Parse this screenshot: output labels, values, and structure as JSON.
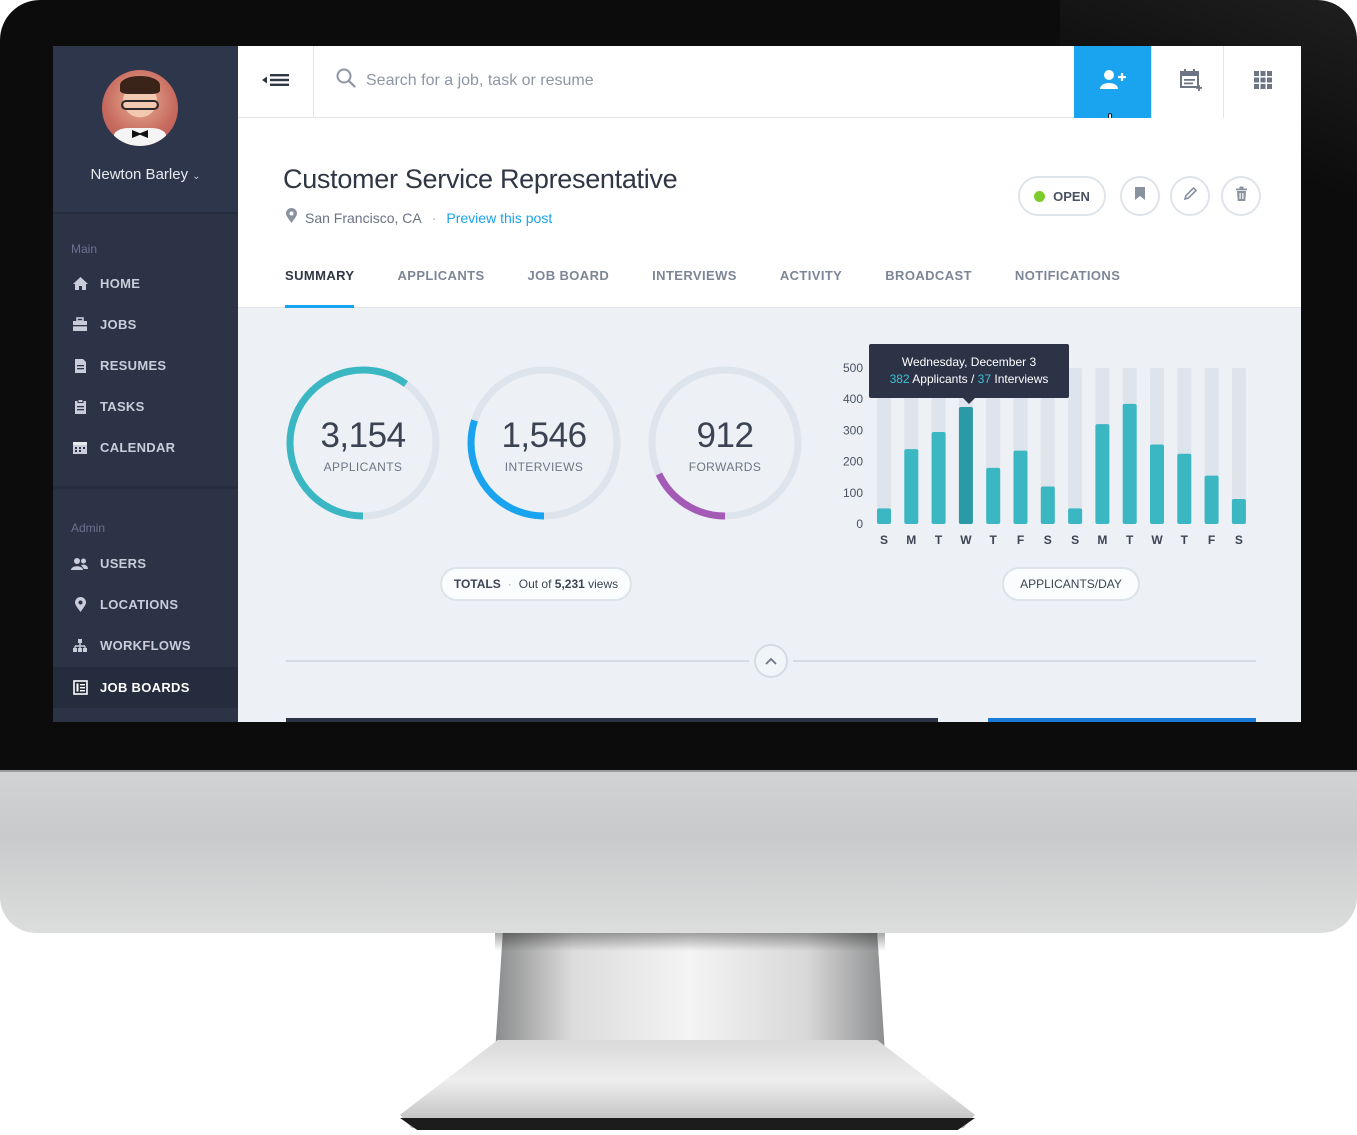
{
  "user": {
    "name": "Newton Barley"
  },
  "sidebar": {
    "main_label": "Main",
    "admin_label": "Admin",
    "main_items": [
      {
        "label": "HOME",
        "icon": "home-icon"
      },
      {
        "label": "JOBS",
        "icon": "briefcase-icon"
      },
      {
        "label": "RESUMES",
        "icon": "document-icon"
      },
      {
        "label": "TASKS",
        "icon": "clipboard-icon"
      },
      {
        "label": "CALENDAR",
        "icon": "calendar-icon"
      }
    ],
    "admin_items": [
      {
        "label": "USERS",
        "icon": "users-icon"
      },
      {
        "label": "LOCATIONS",
        "icon": "location-pin-icon"
      },
      {
        "label": "WORKFLOWS",
        "icon": "workflow-icon"
      },
      {
        "label": "JOB BOARDS",
        "icon": "job-board-icon",
        "active": true
      }
    ]
  },
  "search": {
    "placeholder": "Search for a job, task or resume"
  },
  "topbar": {
    "buttons": [
      "add-user-icon",
      "calendar-add-icon",
      "apps-grid-icon"
    ],
    "primary_color": "#1aa3ee"
  },
  "job": {
    "title": "Customer Service Representative",
    "location": "San Francisco, CA",
    "preview_link": "Preview this post",
    "status": "OPEN",
    "status_color": "#7ccd2b"
  },
  "tabs": [
    {
      "label": "SUMMARY",
      "active": true
    },
    {
      "label": "APPLICANTS"
    },
    {
      "label": "JOB BOARD"
    },
    {
      "label": "INTERVIEWS"
    },
    {
      "label": "ACTIVITY"
    },
    {
      "label": "BROADCAST"
    },
    {
      "label": "NOTIFICATIONS"
    }
  ],
  "stats": [
    {
      "value": "3,154",
      "label": "APPLICANTS",
      "fraction": 0.6,
      "color": "#3bb7c3"
    },
    {
      "value": "1,546",
      "label": "INTERVIEWS",
      "fraction": 0.3,
      "color": "#1aa3ee"
    },
    {
      "value": "912",
      "label": "FORWARDS",
      "fraction": 0.18,
      "color": "#a35bb6"
    }
  ],
  "totals": {
    "label": "TOTALS",
    "separator": "·",
    "text": "Out of",
    "views": "5,231",
    "views_suffix": "views"
  },
  "chart_button": "APPLICANTS/DAY",
  "tooltip": {
    "date": "Wednesday, December 3",
    "applicants_value": "382",
    "applicants_text": "Applicants /",
    "interviews_value": "37",
    "interviews_text": "Interviews"
  },
  "chart_data": {
    "type": "bar",
    "categories": [
      "S",
      "M",
      "T",
      "W",
      "T",
      "F",
      "S",
      "S",
      "M",
      "T",
      "W",
      "T",
      "F",
      "S"
    ],
    "values": [
      50,
      240,
      295,
      375,
      180,
      235,
      120,
      50,
      320,
      385,
      255,
      225,
      155,
      80
    ],
    "ylim": [
      0,
      500
    ],
    "yticks": [
      0,
      100,
      200,
      300,
      400,
      500
    ],
    "highlight_index": 3,
    "bar_color": "#3bb7c3",
    "highlight_color": "#2a9aa6",
    "track_color": "#dde4ec"
  }
}
